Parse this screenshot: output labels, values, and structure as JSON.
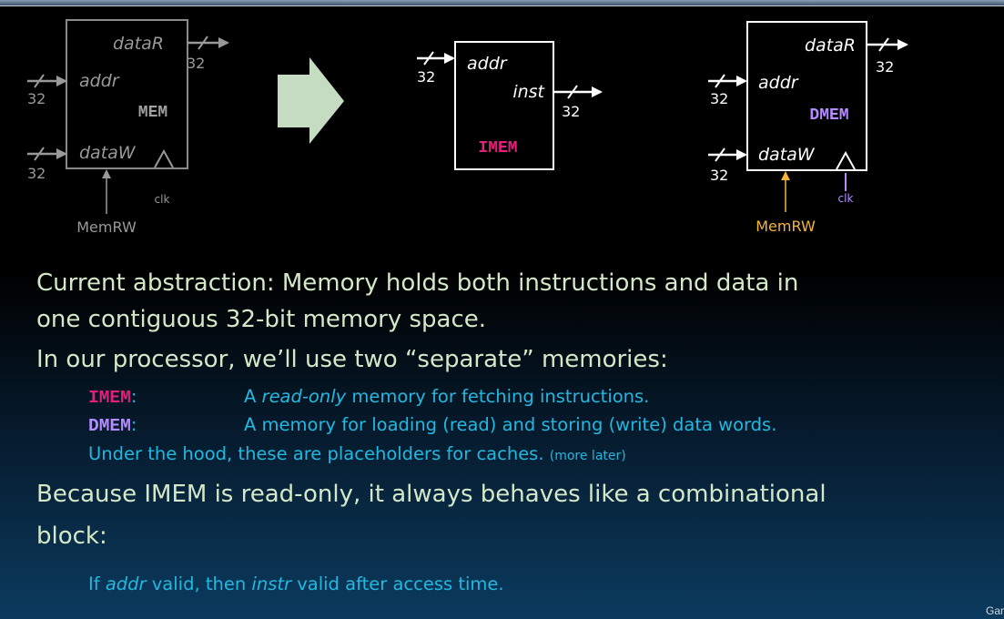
{
  "diagram": {
    "mem": {
      "name": "MEM",
      "dataR": "dataR",
      "addr": "addr",
      "dataW": "dataW",
      "clk": "clk",
      "memrw": "MemRW",
      "w_addr": "32",
      "w_dataW": "32",
      "w_dataR": "32"
    },
    "imem": {
      "name": "IMEM",
      "addr": "addr",
      "inst": "inst",
      "w_addr": "32",
      "w_inst": "32"
    },
    "dmem": {
      "name": "DMEM",
      "dataR": "dataR",
      "addr": "addr",
      "dataW": "dataW",
      "clk": "clk",
      "memrw": "MemRW",
      "w_addr": "32",
      "w_dataW": "32",
      "w_dataR": "32"
    }
  },
  "text": {
    "l1": "Current abstraction: Memory holds both instructions and data in",
    "l2": "one contiguous 32-bit memory space.",
    "l3": "In our processor, we’ll use two “separate” memories:",
    "imem_label": "IMEM",
    "imem_colon": ":",
    "imem_desc_a": "A ",
    "imem_desc_em": "read-only",
    "imem_desc_b": " memory for fetching instructions.",
    "dmem_label": "DMEM",
    "dmem_colon": ":",
    "dmem_desc": "A memory for loading (read) and storing (write) data words.",
    "hood": "Under the hood, these are placeholders for caches.",
    "hood_note": "(more later)",
    "l4": "Because IMEM is read-only, it always behaves like a combinational",
    "l5": "block:",
    "l6_a": "If ",
    "l6_addr": "addr",
    "l6_b": " valid, then ",
    "l6_instr": "instr",
    "l6_c": " valid after access time."
  },
  "footer": "Gar"
}
